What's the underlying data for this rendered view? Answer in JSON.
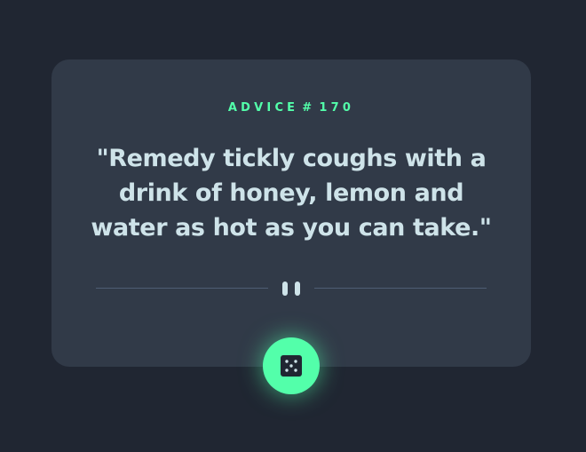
{
  "advice": {
    "label": "ADVICE",
    "hash": "#",
    "id": "170",
    "text": "\"Remedy tickly coughs with a drink of honey, lemon and water as hot as you can take.\""
  },
  "icons": {
    "divider": "pause-icon",
    "button": "dice-icon"
  },
  "colors": {
    "background": "#202632",
    "card": "#313a48",
    "accent": "#53ffaa",
    "text": "#cee3e9",
    "divider": "#4f5d74"
  }
}
